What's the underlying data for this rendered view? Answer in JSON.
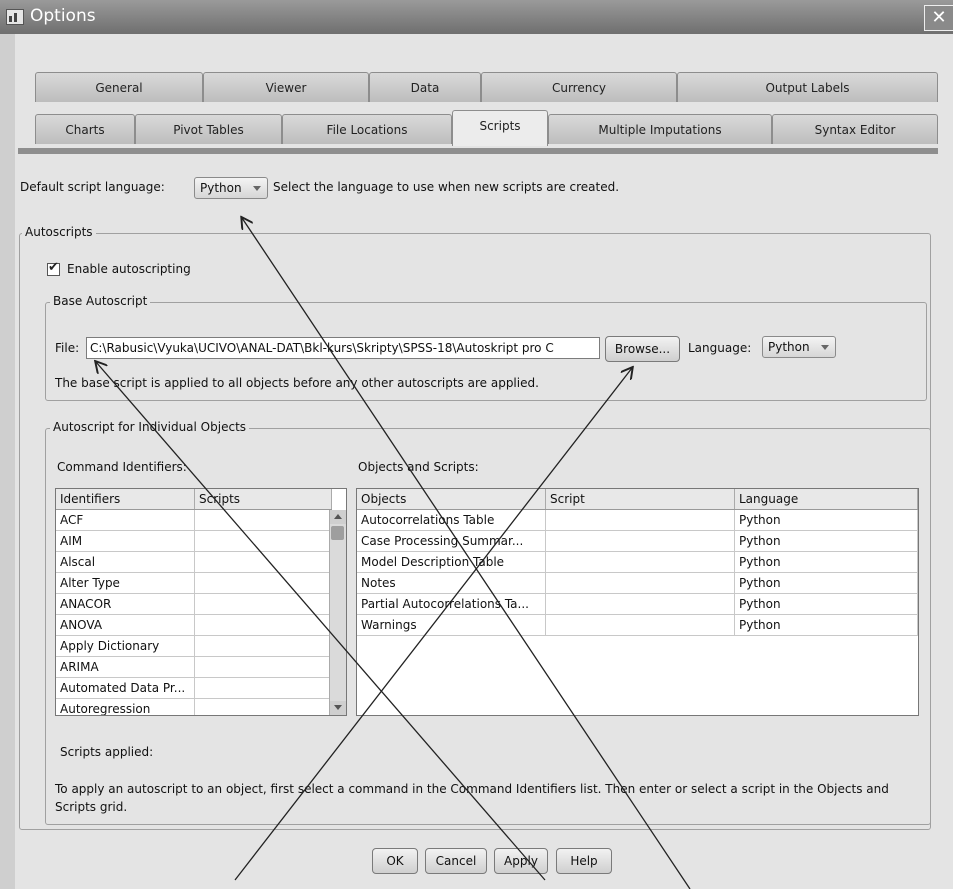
{
  "window": {
    "title": "Options",
    "close_glyph": "✕"
  },
  "tabs_row1": [
    "General",
    "Viewer",
    "Data",
    "Currency",
    "Output Labels"
  ],
  "tabs_row2": [
    "Charts",
    "Pivot Tables",
    "File Locations",
    "Scripts",
    "Multiple Imputations",
    "Syntax Editor"
  ],
  "default_lang": {
    "label": "Default script language:",
    "value": "Python",
    "hint": "Select the language to use when new scripts are created."
  },
  "autoscripts": {
    "legend": "Autoscripts",
    "enable_label": "Enable autoscripting",
    "enabled": true,
    "base": {
      "legend": "Base Autoscript",
      "file_label": "File:",
      "file_value": "C:\\Rabusic\\Vyuka\\UCIVO\\ANAL-DAT\\Bkl-kurs\\Skripty\\SPSS-18\\Autoskript pro C",
      "browse_label": "Browse...",
      "language_label": "Language:",
      "language_value": "Python",
      "note": "The base script is applied to all objects before any other autoscripts are applied."
    },
    "individual": {
      "legend": "Autoscript for Individual Objects",
      "cmd_label": "Command Identifiers:",
      "obj_label": "Objects and Scripts:",
      "identifiers_headers": [
        "Identifiers",
        "Scripts"
      ],
      "identifiers": [
        "ACF",
        "AIM",
        "Alscal",
        "Alter Type",
        "ANACOR",
        "ANOVA",
        "Apply Dictionary",
        "ARIMA",
        "Automated Data Pr...",
        "Autoregression"
      ],
      "objects_headers": [
        "Objects",
        "Script",
        "Language"
      ],
      "objects": [
        {
          "object": "Autocorrelations Table",
          "script": "",
          "language": "Python"
        },
        {
          "object": "Case Processing Summar...",
          "script": "",
          "language": "Python"
        },
        {
          "object": "Model Description Table",
          "script": "",
          "language": "Python"
        },
        {
          "object": "Notes",
          "script": "",
          "language": "Python"
        },
        {
          "object": "Partial Autocorrelations Ta...",
          "script": "",
          "language": "Python"
        },
        {
          "object": "Warnings",
          "script": "",
          "language": "Python"
        }
      ],
      "scripts_applied": "Scripts applied:",
      "instructions": "To apply an autoscript to an object, first select a command in the Command Identifiers list. Then enter or select a script in the Objects and Scripts grid."
    }
  },
  "buttons": {
    "ok": "OK",
    "cancel": "Cancel",
    "apply": "Apply",
    "help": "Help"
  }
}
